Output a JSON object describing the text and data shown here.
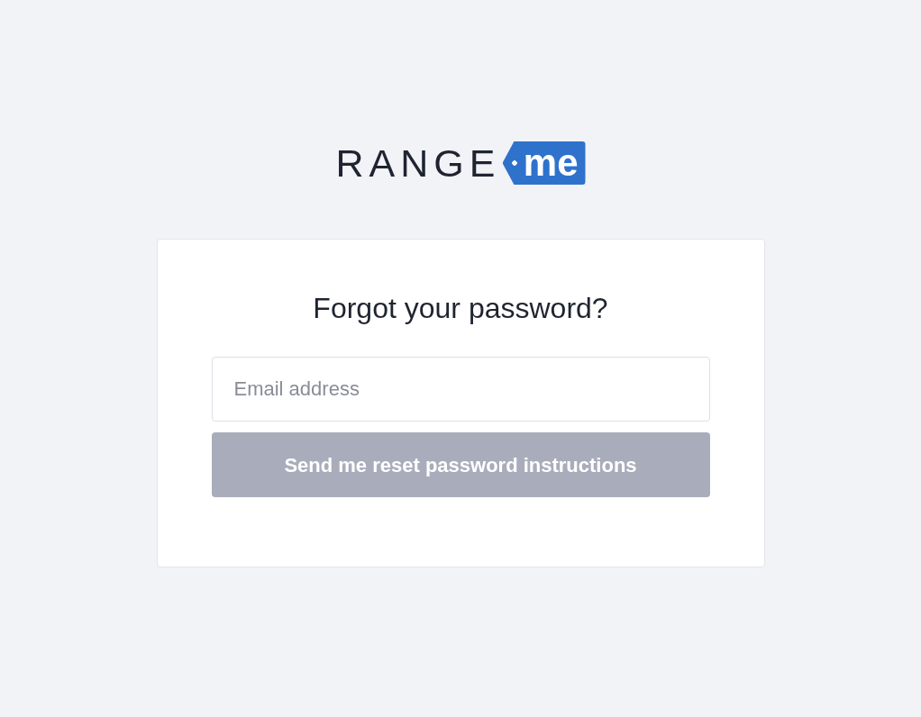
{
  "logo": {
    "word": "RANGE",
    "tag": "me"
  },
  "card": {
    "title": "Forgot your password?",
    "email": {
      "placeholder": "Email address"
    },
    "submit": {
      "label": "Send me reset password instructions",
      "disabled": true
    }
  }
}
